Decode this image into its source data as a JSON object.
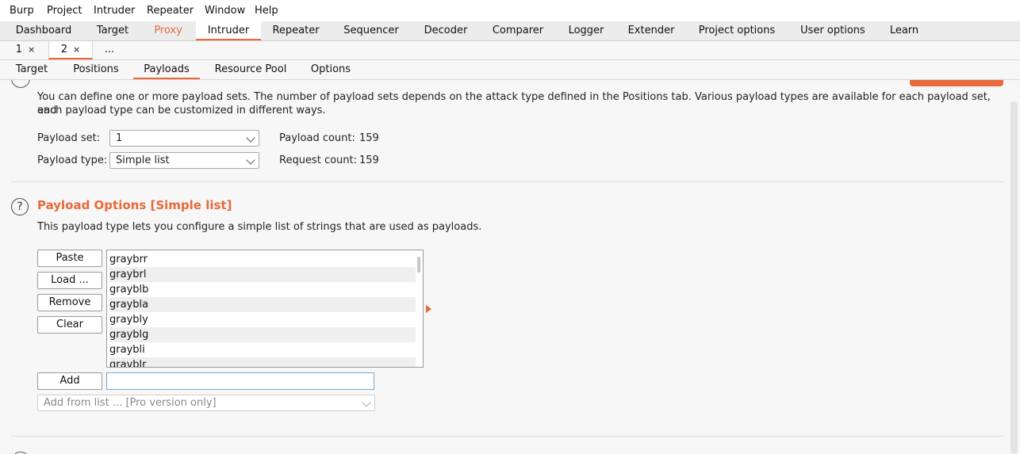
{
  "menubar": [
    "Burp",
    "Project",
    "Intruder",
    "Repeater",
    "Window",
    "Help"
  ],
  "main_tabs": [
    "Dashboard",
    "Target",
    "Proxy",
    "Intruder",
    "Repeater",
    "Sequencer",
    "Decoder",
    "Comparer",
    "Logger",
    "Extender",
    "Project options",
    "User options",
    "Learn"
  ],
  "instance_tabs": [
    {
      "label": "1",
      "close": "×"
    },
    {
      "label": "2",
      "close": "×"
    },
    {
      "label": "..."
    }
  ],
  "sub_tabs": [
    "Target",
    "Positions",
    "Payloads",
    "Resource Pool",
    "Options"
  ],
  "payload_sets": {
    "description_line1": "You can define one or more payload sets. The number of payload sets depends on the attack type defined in the Positions tab. Various payload types are available for each payload set, and",
    "description_line2": "each payload type can be customized in different ways.",
    "set_label": "Payload set:",
    "set_value": "1",
    "type_label": "Payload type:",
    "type_value": "Simple list",
    "payload_count_label": "Payload count:",
    "payload_count": "159",
    "request_count_label": "Request count:",
    "request_count": "159"
  },
  "payload_options": {
    "help_glyph": "?",
    "title": "Payload Options [Simple list]",
    "description": "This payload type lets you configure a simple list of strings that are used as payloads.",
    "buttons": {
      "paste": "Paste",
      "load": "Load ...",
      "remove": "Remove",
      "clear": "Clear",
      "add": "Add"
    },
    "items": [
      "graybrr",
      "graybrl",
      "grayblb",
      "graybla",
      "graybly",
      "grayblg",
      "graybli",
      "grayblr"
    ],
    "add_input_value": "",
    "add_from_list": "Add from list ... [Pro version only]"
  },
  "colors": {
    "accent": "#e8693a"
  }
}
